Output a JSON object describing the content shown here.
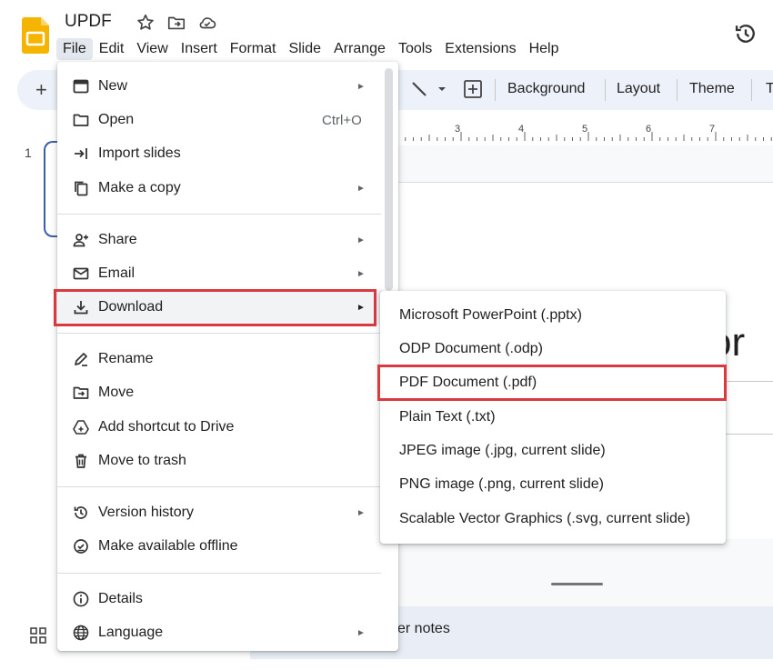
{
  "app": {
    "doc_title": "UPDF",
    "icons": [
      "star-icon",
      "move-folder-icon",
      "cloud-status-icon",
      "version-history-icon"
    ]
  },
  "menubar": {
    "items": [
      "File",
      "Edit",
      "View",
      "Insert",
      "Format",
      "Slide",
      "Arrange",
      "Tools",
      "Extensions",
      "Help"
    ],
    "active": "File"
  },
  "toolbar": {
    "plus": "+",
    "background": "Background",
    "layout": "Layout",
    "theme": "Theme",
    "overflow": "T"
  },
  "ruler": {
    "numbers": [
      "3",
      "4",
      "5",
      "6",
      "7"
    ]
  },
  "slides": {
    "slide_number": "1",
    "visible_title_fragment": "or",
    "notes_fragment": "er notes"
  },
  "file_menu": {
    "items": [
      {
        "label": "New",
        "icon": "new-presentation-icon",
        "submenu": true
      },
      {
        "label": "Open",
        "icon": "folder-icon",
        "shortcut": "Ctrl+O"
      },
      {
        "label": "Import slides",
        "icon": "import-icon"
      },
      {
        "label": "Make a copy",
        "icon": "copy-icon",
        "submenu": true
      },
      {
        "label": "Share",
        "icon": "add-person-icon",
        "submenu": true
      },
      {
        "label": "Email",
        "icon": "email-icon",
        "submenu": true
      },
      {
        "label": "Download",
        "icon": "download-icon",
        "submenu": true,
        "highlighted": true
      },
      {
        "label": "Rename",
        "icon": "rename-icon"
      },
      {
        "label": "Move",
        "icon": "move-folder-icon"
      },
      {
        "label": "Add shortcut to Drive",
        "icon": "drive-shortcut-icon"
      },
      {
        "label": "Move to trash",
        "icon": "trash-icon"
      },
      {
        "label": "Version history",
        "icon": "history-icon",
        "submenu": true
      },
      {
        "label": "Make available offline",
        "icon": "offline-icon"
      },
      {
        "label": "Details",
        "icon": "info-icon"
      },
      {
        "label": "Language",
        "icon": "globe-icon",
        "submenu": true
      }
    ]
  },
  "download_menu": {
    "items": [
      "Microsoft PowerPoint (.pptx)",
      "ODP Document (.odp)",
      "PDF Document (.pdf)",
      "Plain Text (.txt)",
      "JPEG image (.jpg, current slide)",
      "PNG image (.png, current slide)",
      "Scalable Vector Graphics (.svg, current slide)"
    ],
    "highlighted": "PDF Document (.pdf)"
  },
  "colors": {
    "highlight_border": "#d93a40",
    "toolbar_bg": "#edf2fa",
    "logo_yellow": "#f5b400"
  }
}
